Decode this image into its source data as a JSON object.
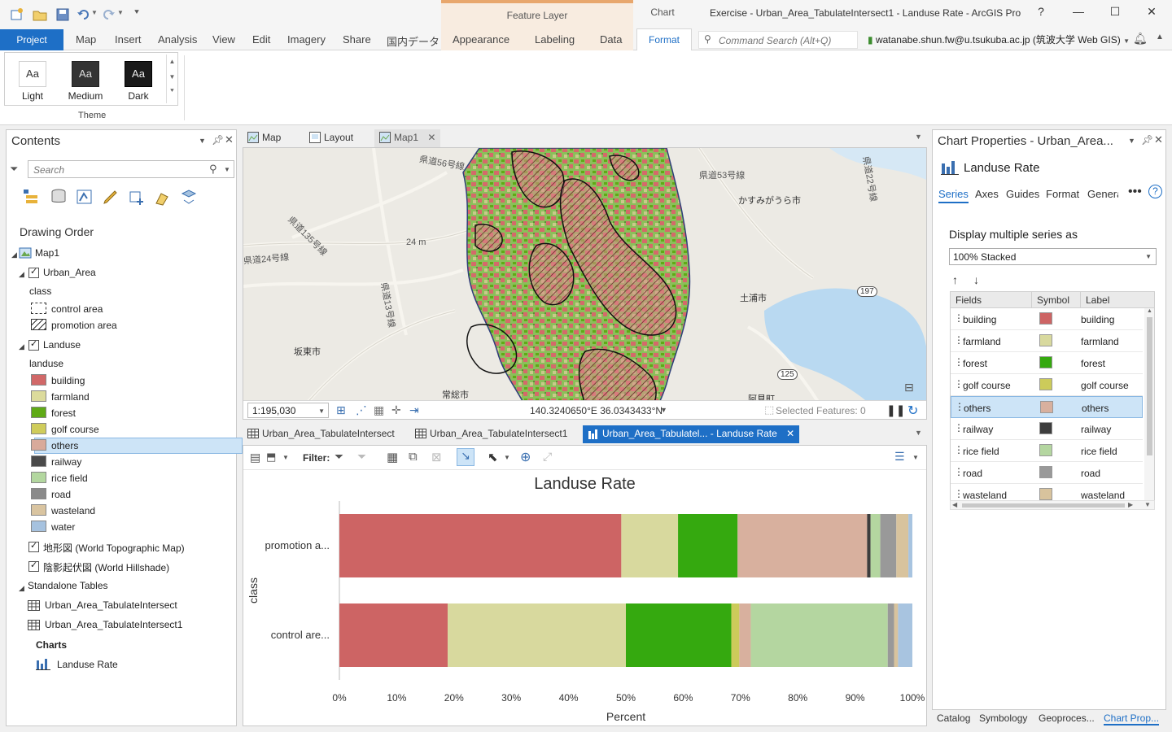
{
  "app": {
    "window_title": "Exercise - Urban_Area_TabulateIntersect1 - Landuse Rate - ArcGIS Pro",
    "help": "?",
    "context_tabs": {
      "feature_layer": "Feature Layer",
      "chart": "Chart"
    }
  },
  "ribbon": {
    "tabs": [
      "Project",
      "Map",
      "Insert",
      "Analysis",
      "View",
      "Edit",
      "Imagery",
      "Share",
      "国内データ",
      "Appearance",
      "Labeling",
      "Data",
      "Format"
    ],
    "active_tab": "Format",
    "command_search_placeholder": "Command Search (Alt+Q)",
    "user": "watanabe.shun.fw@u.tsukuba.ac.jp (筑波大学 Web GIS)",
    "theme_group": {
      "label": "Theme",
      "items": [
        {
          "label": "Light",
          "sample": "Aa"
        },
        {
          "label": "Medium",
          "sample": "Aa"
        },
        {
          "label": "Dark",
          "sample": "Aa"
        }
      ]
    }
  },
  "contents": {
    "title": "Contents",
    "search_placeholder": "Search",
    "drawing_order": "Drawing Order",
    "map_name": "Map1",
    "urban_layer": "Urban_Area",
    "urban_field": "class",
    "urban_classes": [
      "control area",
      "promotion area"
    ],
    "landuse_layer": "Landuse",
    "landuse_field": "landuse",
    "landuse_classes": [
      {
        "label": "building",
        "color": "#d16868"
      },
      {
        "label": "farmland",
        "color": "#dcdb9c"
      },
      {
        "label": "forest",
        "color": "#5faa16"
      },
      {
        "label": "golf course",
        "color": "#cfcc5b"
      },
      {
        "label": "others",
        "color": "#d8aa9b"
      },
      {
        "label": "railway",
        "color": "#4a4a4a"
      },
      {
        "label": "rice field",
        "color": "#b3d79f"
      },
      {
        "label": "road",
        "color": "#8a8a8a"
      },
      {
        "label": "wasteland",
        "color": "#d9c4a0"
      },
      {
        "label": "water",
        "color": "#a6c2df"
      }
    ],
    "basemaps": [
      "地形図 (World Topographic Map)",
      "陰影起伏図 (World Hillshade)"
    ],
    "standalone_tables_label": "Standalone Tables",
    "tables": [
      "Urban_Area_TabulateIntersect",
      "Urban_Area_TabulateIntersect1"
    ],
    "charts_label": "Charts",
    "charts": [
      "Landuse Rate"
    ]
  },
  "views": {
    "top_tabs": [
      "Map",
      "Layout",
      "Map1"
    ],
    "bottom_tabs": [
      "Urban_Area_TabulateIntersect",
      "Urban_Area_TabulateIntersect1",
      "Urban_Area_Tabulatel... - Landuse Rate"
    ]
  },
  "map": {
    "scale": "1:195,030",
    "coordinates": "140.3240650°E 36.0343433°N",
    "selected_features": "Selected Features: 0",
    "labels": [
      "県道56号線",
      "県道53号線",
      "かすみがうら市",
      "県道135号線",
      "24 m",
      "県道24号線",
      "土浦市",
      "坂東市",
      "常総市",
      "阿見町",
      "県道13号線",
      "197",
      "125",
      "県道22号線"
    ]
  },
  "chart_toolbar": {
    "filter_label": "Filter:"
  },
  "chart_data": {
    "type": "bar",
    "orientation": "horizontal",
    "stacking": "100% stacked",
    "title": "Landuse Rate",
    "xlabel": "Percent",
    "ylabel": "class",
    "categories": [
      "promotion a...",
      "control are..."
    ],
    "xlim": [
      0,
      100
    ],
    "xticks": [
      "0%",
      "10%",
      "20%",
      "30%",
      "40%",
      "50%",
      "60%",
      "70%",
      "80%",
      "90%",
      "100%"
    ],
    "series": [
      {
        "name": "building",
        "color": "#cd6464",
        "values": [
          49.2,
          18.9
        ]
      },
      {
        "name": "farmland",
        "color": "#d8d99e",
        "values": [
          9.9,
          31.1
        ]
      },
      {
        "name": "forest",
        "color": "#35a90f",
        "values": [
          10.4,
          18.4
        ]
      },
      {
        "name": "golf course",
        "color": "#cccb5a",
        "values": [
          0.0,
          1.4
        ]
      },
      {
        "name": "others",
        "color": "#d8b09e",
        "values": [
          22.6,
          2.0
        ]
      },
      {
        "name": "railway",
        "color": "#3d3d3d",
        "values": [
          0.6,
          0.0
        ]
      },
      {
        "name": "rice field",
        "color": "#b4d6a0",
        "values": [
          1.7,
          23.9
        ]
      },
      {
        "name": "road",
        "color": "#999999",
        "values": [
          2.8,
          1.1
        ]
      },
      {
        "name": "wasteland",
        "color": "#d8c39d",
        "values": [
          2.1,
          0.7
        ]
      },
      {
        "name": "water",
        "color": "#a8c4e0",
        "values": [
          0.7,
          2.5
        ]
      }
    ]
  },
  "chart_properties": {
    "title": "Chart Properties - Urban_Area...",
    "chart_name": "Landuse Rate",
    "tabs": [
      "Series",
      "Axes",
      "Guides",
      "Format",
      "Genera"
    ],
    "active_tab": "Series",
    "display_multiple_label": "Display multiple series as",
    "display_multiple_value": "100% Stacked",
    "columns": [
      "Fields",
      "Symbol",
      "Label"
    ],
    "rows": [
      {
        "field": "building",
        "label": "building",
        "color": "#cd6464"
      },
      {
        "field": "farmland",
        "label": "farmland",
        "color": "#d8d99e"
      },
      {
        "field": "forest",
        "label": "forest",
        "color": "#35a90f"
      },
      {
        "field": "golf course",
        "label": "golf course",
        "color": "#cccb5a"
      },
      {
        "field": "others",
        "label": "others",
        "color": "#d8b09e"
      },
      {
        "field": "railway",
        "label": "railway",
        "color": "#3d3d3d"
      },
      {
        "field": "rice field",
        "label": "rice field",
        "color": "#b4d6a0"
      },
      {
        "field": "road",
        "label": "road",
        "color": "#999999"
      },
      {
        "field": "wasteland",
        "label": "wasteland",
        "color": "#d8c39d"
      }
    ],
    "selected_row": "others"
  },
  "dock_tabs": [
    "Catalog",
    "Symbology",
    "Geoproces...",
    "Chart Prop..."
  ]
}
